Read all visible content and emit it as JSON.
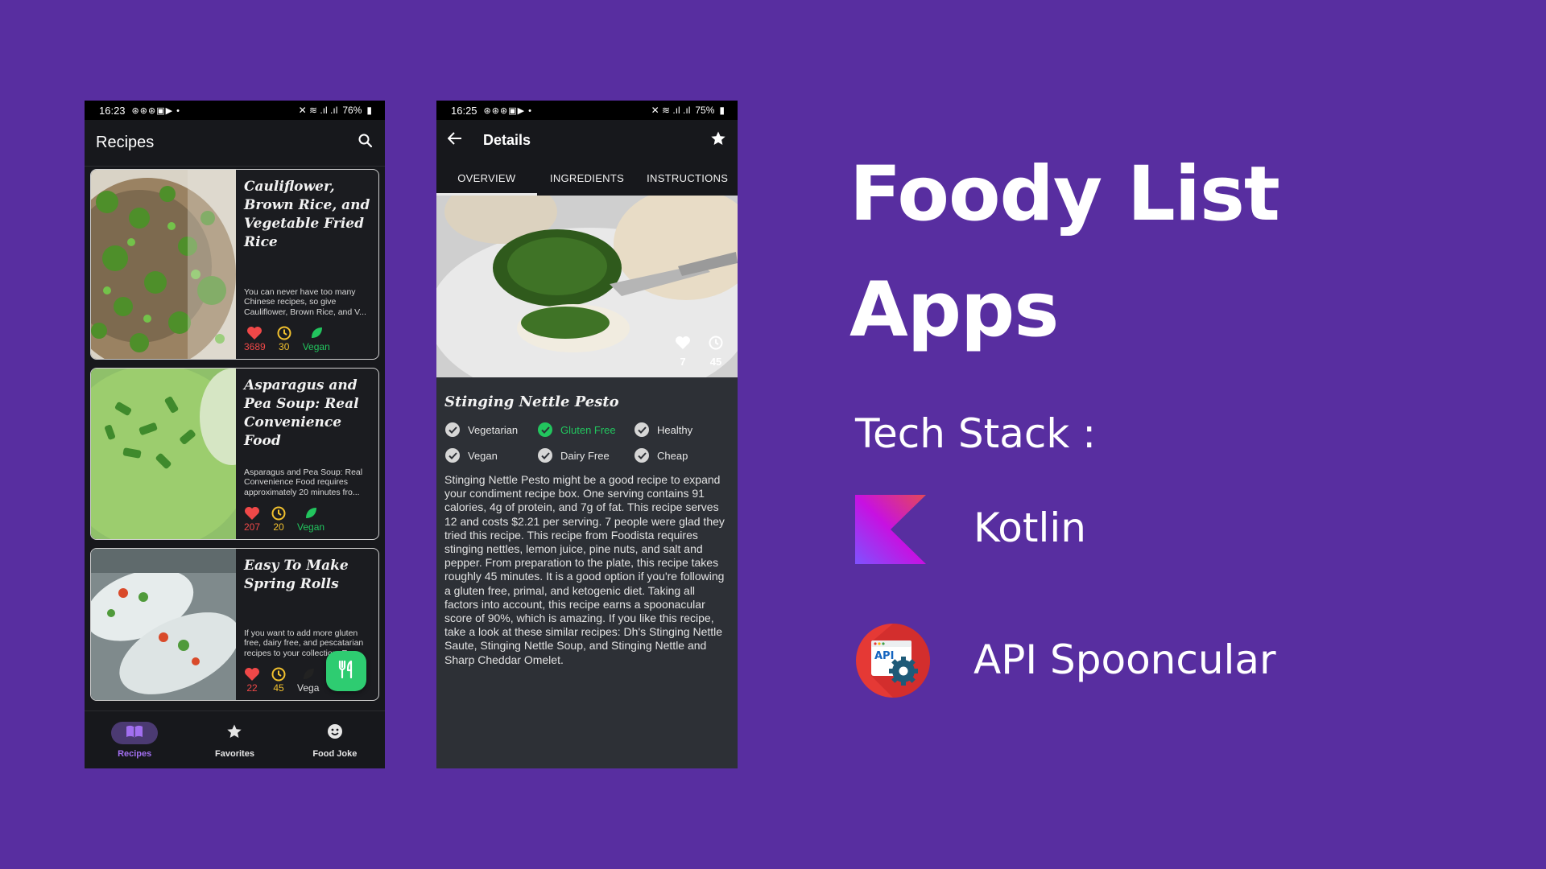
{
  "phone1": {
    "status": {
      "time": "16:23",
      "battery": "76%"
    },
    "appbar": {
      "title": "Recipes"
    },
    "recipes": [
      {
        "title": "Cauliflower, Brown Rice, and Vegetable Fried Rice",
        "description": "You can never have too many Chinese recipes, so give Cauliflower, Brown Rice, and V...",
        "likes": "3689",
        "minutes": "30",
        "diet": "Vegan"
      },
      {
        "title": "Asparagus and Pea Soup: Real Convenience Food",
        "description": "Asparagus and Pea Soup: Real Convenience Food requires approximately 20 minutes fro...",
        "likes": "207",
        "minutes": "20",
        "diet": "Vegan"
      },
      {
        "title": "Easy To Make Spring Rolls",
        "description": "If you want to add more gluten free, dairy free, and pescatarian recipes to your collection, Eas...",
        "likes": "22",
        "minutes": "45",
        "diet": "Vega"
      }
    ],
    "nav": {
      "recipes": "Recipes",
      "favorites": "Favorites",
      "food_joke": "Food Joke"
    }
  },
  "phone2": {
    "status": {
      "time": "16:25",
      "battery": "75%"
    },
    "appbar": {
      "title": "Details"
    },
    "tabs": [
      "OVERVIEW",
      "INGREDIENTS",
      "INSTRUCTIONS"
    ],
    "likes": "7",
    "minutes": "45",
    "title": "Stinging Nettle Pesto",
    "tags": [
      {
        "label": "Vegetarian",
        "on": false
      },
      {
        "label": "Gluten Free",
        "on": true
      },
      {
        "label": "Healthy",
        "on": false
      },
      {
        "label": "Vegan",
        "on": false
      },
      {
        "label": "Dairy Free",
        "on": false
      },
      {
        "label": "Cheap",
        "on": false
      }
    ],
    "summary": "Stinging Nettle Pesto might be a good recipe to expand your condiment recipe box. One serving contains 91 calories, 4g of protein, and 7g of fat. This recipe serves 12 and costs $2.21 per serving. 7 people were glad they tried this recipe. This recipe from Foodista requires stinging nettles, lemon juice, pine nuts, and salt and pepper. From preparation to the plate, this recipe takes roughly 45 minutes. It is a good option if you're following a gluten free, primal, and ketogenic diet. Taking all factors into account, this recipe earns a spoonacular score of 90%, which is amazing. If you like this recipe, take a look at these similar recipes: Dh's Stinging Nettle Saute, Stinging Nettle Soup, and Stinging Nettle and Sharp Cheddar Omelet."
  },
  "headline": {
    "line1": "Foody List",
    "line2": "Apps"
  },
  "tech": {
    "heading": "Tech Stack :",
    "items": [
      {
        "label": "Kotlin",
        "icon": "kotlin-logo"
      },
      {
        "label": "API Spooncular",
        "icon": "api-settings-logo"
      }
    ]
  },
  "colors": {
    "background": "#582ea0",
    "accent_green": "#22c55e",
    "heart_red": "#ef4848",
    "clock_yellow": "#f2c12e",
    "nav_active": "#a26ff0"
  }
}
